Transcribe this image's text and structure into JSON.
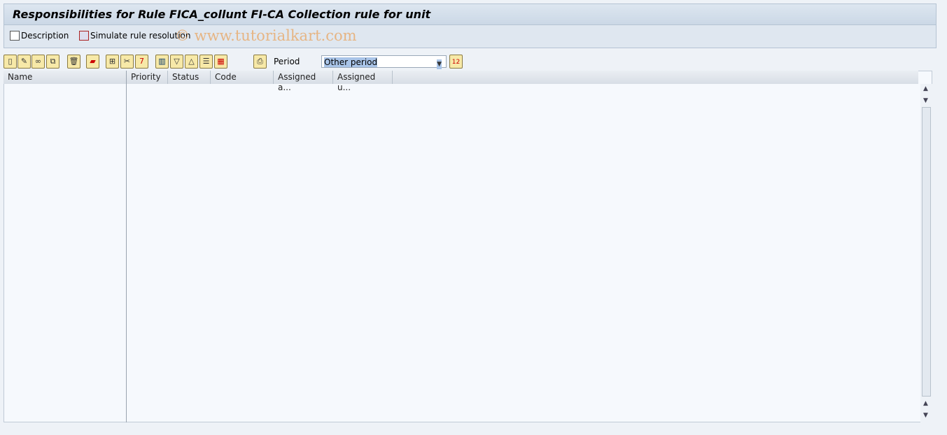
{
  "title": "Responsibilities for Rule FICA_collunt FI-CA Collection rule for unit",
  "app_toolbar": {
    "description": "Description",
    "simulate": "Simulate rule resolution"
  },
  "watermark": "© www.tutorialkart.com",
  "toolbar": {
    "icons": [
      "create-icon",
      "edit-icon",
      "display-icon",
      "copy-icon",
      "delete-icon",
      "transport-icon",
      "hierarchy-icon",
      "cut-icon",
      "date-icon",
      "columns-icon",
      "expand-icon",
      "collapse-icon",
      "list-icon",
      "layout-icon",
      "print-icon"
    ],
    "period_label": "Period",
    "period_value": "Other period"
  },
  "table": {
    "left_header": "Name",
    "columns": [
      "Priority",
      "Status",
      "Code",
      "Assigned a...",
      "Assigned u..."
    ]
  }
}
